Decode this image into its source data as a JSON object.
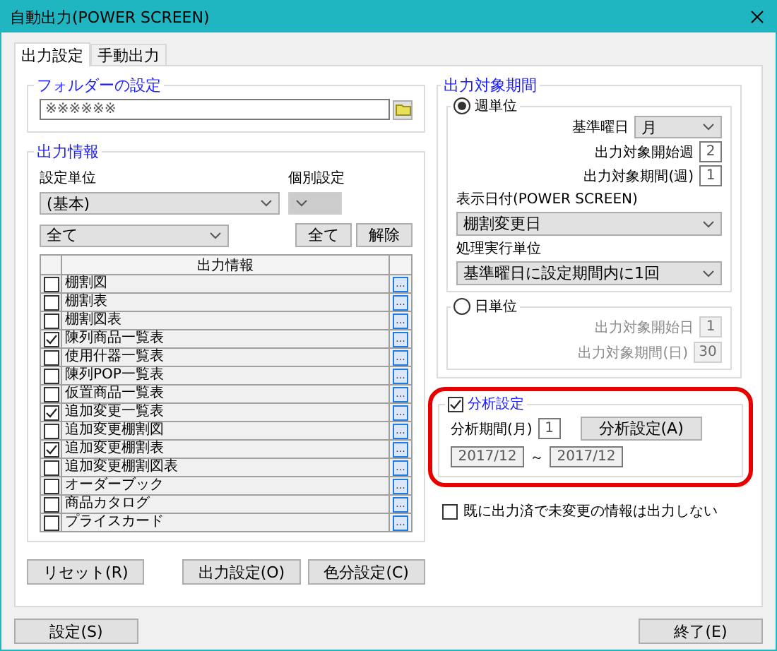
{
  "window": {
    "title": "自動出力(POWER SCREEN)"
  },
  "tabs": [
    {
      "label": "出力設定",
      "selected": true
    },
    {
      "label": "手動出力",
      "selected": false
    }
  ],
  "folder": {
    "legend": "フォルダーの設定",
    "value": "※※※※※※"
  },
  "output_info": {
    "legend": "出力情報",
    "unit_label": "設定単位",
    "unit_value": "(基本)",
    "individual_label": "個別設定",
    "individual_disabled": true,
    "filter_value": "全て",
    "select_all": "全て",
    "clear": "解除",
    "table": {
      "header": "出力情報",
      "rows": [
        {
          "label": "棚割図",
          "checked": false,
          "more": "..."
        },
        {
          "label": "棚割表",
          "checked": false,
          "more": "..."
        },
        {
          "label": "棚割図表",
          "checked": false,
          "more": "..."
        },
        {
          "label": "陳列商品一覧表",
          "checked": true,
          "more": "..."
        },
        {
          "label": "使用什器一覧表",
          "checked": false,
          "more": "..."
        },
        {
          "label": "陳列POP一覧表",
          "checked": false,
          "more": "..."
        },
        {
          "label": "仮置商品一覧表",
          "checked": false,
          "more": "..."
        },
        {
          "label": "追加変更一覧表",
          "checked": true,
          "more": "..."
        },
        {
          "label": "追加変更棚割図",
          "checked": false,
          "more": "..."
        },
        {
          "label": "追加変更棚割表",
          "checked": true,
          "more": "..."
        },
        {
          "label": "追加変更棚割図表",
          "checked": false,
          "more": "..."
        },
        {
          "label": "オーダーブック",
          "checked": false,
          "more": "..."
        },
        {
          "label": "商品カタログ",
          "checked": false,
          "more": "..."
        },
        {
          "label": "プライスカード",
          "checked": false,
          "more": "..."
        }
      ]
    }
  },
  "left_buttons": [
    "リセット(R)",
    "出力設定(O)",
    "色分設定(C)"
  ],
  "period": {
    "legend": "出力対象期間",
    "weekly": {
      "label": "週単位",
      "selected": true,
      "weekday_label": "基準曜日",
      "weekday_value": "月",
      "start_label": "出力対象開始週",
      "start_value": "2",
      "length_label": "出力対象期間(週)",
      "length_value": "1",
      "display_label": "表示日付(POWER SCREEN)",
      "display_value": "棚割変更日",
      "unit_label": "処理実行単位",
      "unit_value": "基準曜日に設定期間内に1回"
    },
    "daily": {
      "label": "日単位",
      "selected": false,
      "disabled": true,
      "start_label": "出力対象開始日",
      "start_value": "1",
      "length_label": "出力対象期間(日)",
      "length_value": "30"
    }
  },
  "analysis": {
    "legend": "分析設定",
    "checked": true,
    "period_label": "分析期間(月)",
    "period_value": "1",
    "button": "分析設定(A)",
    "from": "2017/12",
    "separator": "～",
    "to": "2017/12"
  },
  "skip_unchanged": {
    "label": "既に出力済で未変更の情報は出力しない",
    "checked": false
  },
  "footer": {
    "left": "設定(S)",
    "right": "終了(E)"
  }
}
